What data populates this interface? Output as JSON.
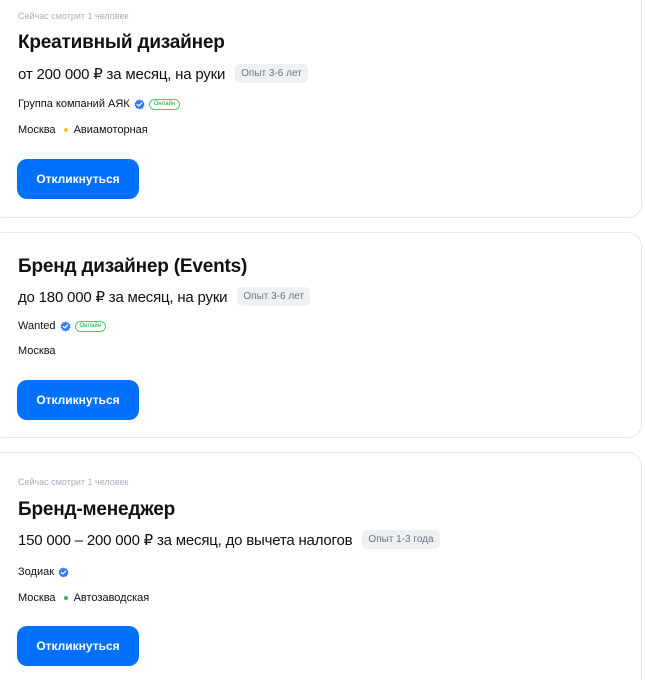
{
  "vacancies": [
    {
      "watching": "Сейчас смотрит 1 человек",
      "title": "Креативный дизайнер",
      "salary": "от 200 000 ₽ за месяц, на руки",
      "experience": "Опыт 3-6 лет",
      "company": "Группа компаний АЯК",
      "online_label": "Онлайн",
      "city": "Москва",
      "metro": "Авиамоторная",
      "metro_color": "#ffc020",
      "apply_label": "Откликнуться"
    },
    {
      "title": "Бренд дизайнер (Events)",
      "salary": "до 180 000 ₽ за месяц, на руки",
      "experience": "Опыт 3-6 лет",
      "company": "Wanted",
      "online_label": "Онлайн",
      "city": "Москва",
      "apply_label": "Откликнуться"
    },
    {
      "watching": "Сейчас смотрит 1 человек",
      "title": "Бренд-менеджер",
      "salary": "150 000 – 200 000 ₽ за месяц, до вычета налогов",
      "experience": "Опыт 1-3 года",
      "company": "Зодиак",
      "city": "Москва",
      "metro": "Автозаводская",
      "metro_color": "#2db34a",
      "apply_label": "Откликнуться"
    }
  ],
  "colors": {
    "accent": "#0070ff",
    "verified": "#2f7cf6",
    "online": "#17a34a"
  }
}
